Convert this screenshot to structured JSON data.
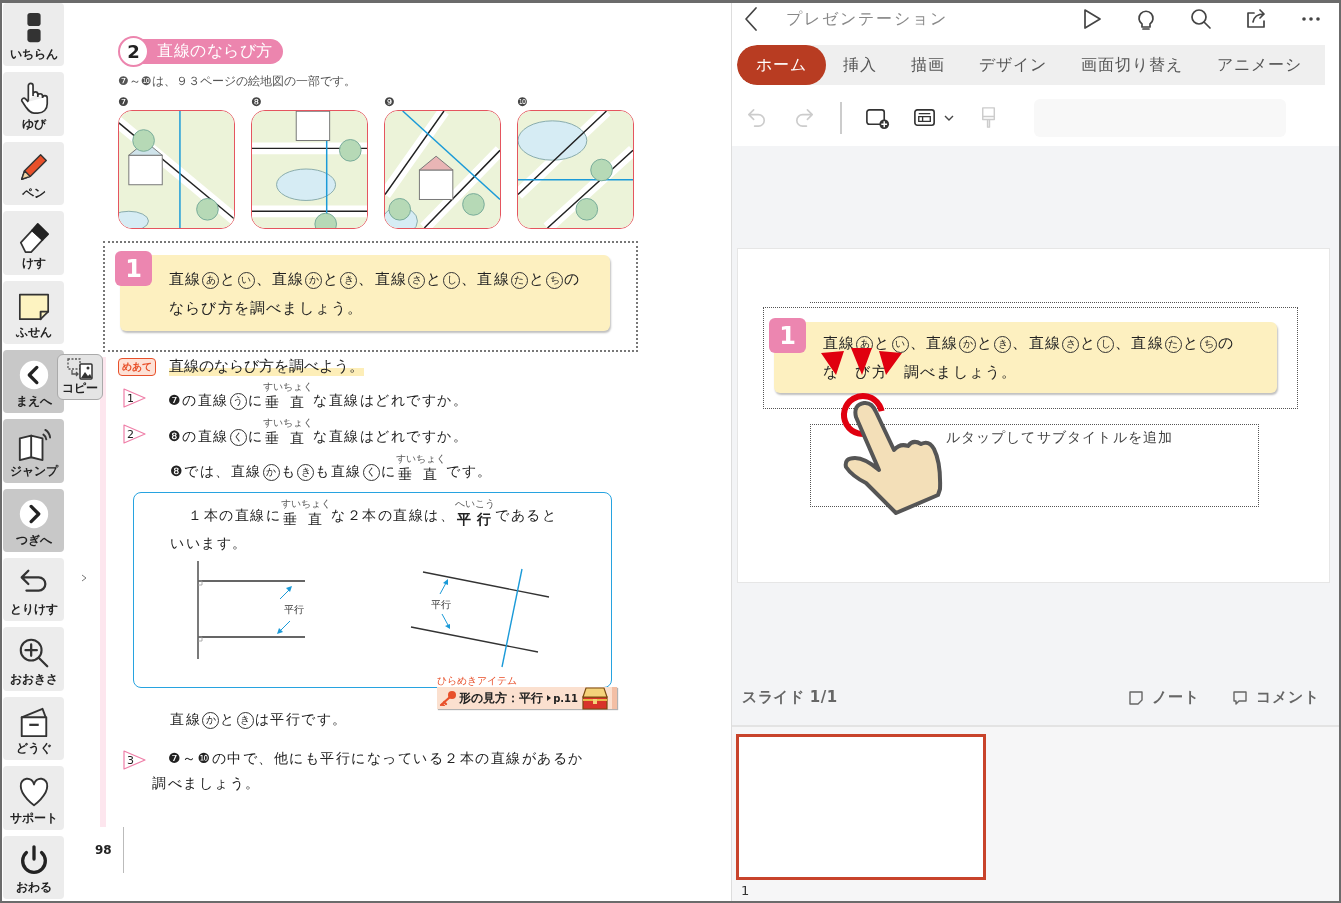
{
  "sidebar": {
    "tools": [
      {
        "label": "いちらん",
        "kind": "tool"
      },
      {
        "label": "ゆび",
        "kind": "tool"
      },
      {
        "label": "ペン",
        "kind": "tool"
      },
      {
        "label": "けす",
        "kind": "tool"
      },
      {
        "label": "ふせん",
        "kind": "tool"
      },
      {
        "label": "まえへ",
        "kind": "page"
      },
      {
        "label": "ジャンプ",
        "kind": "page"
      },
      {
        "label": "つぎへ",
        "kind": "page"
      },
      {
        "label": "とりけす",
        "kind": "tool"
      },
      {
        "label": "おおきさ",
        "kind": "tool"
      },
      {
        "label": "どうぐ",
        "kind": "tool"
      },
      {
        "label": "サポート",
        "kind": "tool"
      },
      {
        "label": "おわる",
        "kind": "tool"
      }
    ],
    "copy_button": "コピー"
  },
  "page": {
    "section_number": "2",
    "section_title": "直線のならび方",
    "note": "❼～❿は、９３ページの絵地図の一部です。",
    "map_numbers": [
      "❼",
      "❽",
      "❾",
      "❿"
    ],
    "task": {
      "number": "1",
      "lines": [
        [
          "直線",
          {
            "text": "あ",
            "circled": true
          },
          "と",
          {
            "text": "い",
            "circled": true
          },
          "、直線",
          {
            "text": "か",
            "circled": true
          },
          "と",
          {
            "text": "き",
            "circled": true
          },
          "、直線",
          {
            "text": "さ",
            "circled": true
          },
          "と",
          {
            "text": "し",
            "circled": true
          },
          "、直線",
          {
            "text": "た",
            "circled": true
          },
          "と",
          {
            "text": "ち",
            "circled": true
          },
          "の"
        ],
        [
          "ならび方を調べましょう。"
        ]
      ]
    },
    "goal": {
      "badge": "めあて",
      "text": "直線のならび方を調べよう。"
    },
    "questions": [
      {
        "number": "1",
        "lines": [
          [
            "❼の直線",
            {
              "text": "う",
              "circled": true
            },
            "に",
            {
              "text": "垂",
              "ruby": "すい"
            },
            {
              "text": "直",
              "ruby": "ちょく"
            },
            "な直線はどれですか。"
          ]
        ]
      },
      {
        "number": "2",
        "lines": [
          [
            "❽の直線",
            {
              "text": "く",
              "circled": true
            },
            "に",
            {
              "text": "垂",
              "ruby": "すい"
            },
            {
              "text": "直",
              "ruby": "ちょく"
            },
            "な直線はどれですか。"
          ]
        ]
      }
    ],
    "explanation": [
      [
        "❽では、直線",
        {
          "text": "か",
          "circled": true
        },
        "も",
        {
          "text": "き",
          "circled": true
        },
        "も直線",
        {
          "text": "く",
          "circled": true
        },
        "に",
        {
          "text": "垂",
          "ruby": "すい"
        },
        {
          "text": "直",
          "ruby": "ちょく"
        },
        "です。"
      ]
    ],
    "definition": {
      "lines": [
        [
          "１本の直線に",
          {
            "text": "垂",
            "ruby": "すい"
          },
          {
            "text": "直",
            "ruby": "ちょく"
          },
          "な２本の直線は、",
          {
            "text": "平",
            "ruby": "へい",
            "bold": true
          },
          {
            "text": "行",
            "ruby": "こう",
            "bold": true
          },
          "であると"
        ],
        [
          "いいます。"
        ]
      ],
      "labels": [
        "平行",
        "平行"
      ],
      "hint": {
        "caption": "ひらめきアイテム",
        "title": "形の見方：平行",
        "page": "p.11"
      }
    },
    "conclusion": [
      [
        "直線",
        {
          "text": "か",
          "circled": true
        },
        "と",
        {
          "text": "き",
          "circled": true
        },
        "は平行です。"
      ]
    ],
    "last_question": {
      "number": "3",
      "lines": [
        [
          "❼～❿の中で、他にも平行になっている２本の直線があるか"
        ],
        [
          "調べましょう。"
        ]
      ]
    },
    "page_number": "98"
  },
  "app": {
    "title": "プレゼンテーション",
    "tabs": [
      {
        "label": "ホーム",
        "selected": true
      },
      {
        "label": "挿入",
        "selected": false
      },
      {
        "label": "描画",
        "selected": false
      },
      {
        "label": "デザイン",
        "selected": false
      },
      {
        "label": "画面切り替え",
        "selected": false
      },
      {
        "label": "アニメーシ",
        "selected": false
      }
    ],
    "tools": [
      {
        "disabled": true
      },
      {
        "disabled": true
      },
      {
        "disabled": false
      },
      {
        "disabled": false
      },
      {
        "disabled": true
      }
    ],
    "slide": {
      "subtitle_placeholder": "ルタップしてサブタイトルを追加",
      "pasted": {
        "number": "1",
        "lines": [
          [
            "直線",
            {
              "text": "あ",
              "circled": true
            },
            "と",
            {
              "text": "い",
              "circled": true
            },
            "、直線",
            {
              "text": "か",
              "circled": true
            },
            "と",
            {
              "text": "き",
              "circled": true
            },
            "、直線",
            {
              "text": "さ",
              "circled": true
            },
            "と",
            {
              "text": "し",
              "circled": true
            },
            "、直線",
            {
              "text": "た",
              "circled": true
            },
            "と",
            {
              "text": "ち",
              "circled": true
            },
            "の"
          ],
          [
            "な　び方　調べましょう。"
          ]
        ]
      }
    },
    "slide_counter": "スライド 1/1",
    "notes_button": "ノート",
    "comments_button": "コメント",
    "thumbnails": [
      {
        "number": "1",
        "selected": true
      }
    ]
  }
}
